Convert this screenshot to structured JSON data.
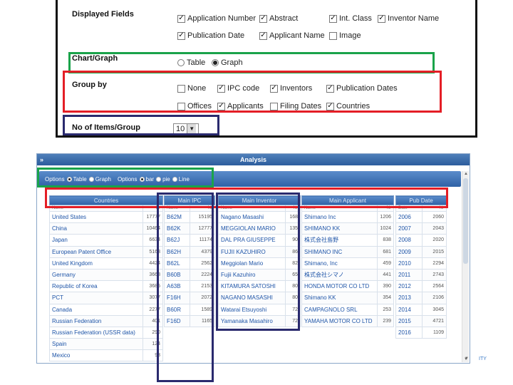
{
  "displayed_fields": {
    "label": "Displayed Fields",
    "options": [
      {
        "label": "Application Number",
        "checked": true
      },
      {
        "label": "Abstract",
        "checked": true
      },
      {
        "label": "Int. Class",
        "checked": true
      },
      {
        "label": "Inventor Name",
        "checked": true
      },
      {
        "label": "Publication Date",
        "checked": true
      },
      {
        "label": "Applicant Name",
        "checked": true
      },
      {
        "label": "Image",
        "checked": false
      }
    ]
  },
  "chart_graph": {
    "label": "Chart/Graph",
    "options": [
      {
        "label": "Table",
        "selected": false
      },
      {
        "label": "Graph",
        "selected": true
      }
    ]
  },
  "group_by": {
    "label": "Group by",
    "options": [
      {
        "label": "None",
        "checked": false
      },
      {
        "label": "IPC code",
        "checked": true
      },
      {
        "label": "Inventors",
        "checked": true
      },
      {
        "label": "Publication Dates",
        "checked": true
      },
      {
        "label": "Offices",
        "checked": false
      },
      {
        "label": "Applicants",
        "checked": true
      },
      {
        "label": "Filing Dates",
        "checked": false
      },
      {
        "label": "Countries",
        "checked": true
      }
    ]
  },
  "items_per_group": {
    "label": "No of Items/Group",
    "value": "10"
  },
  "analysis": {
    "title": "Analysis",
    "collapse": "»",
    "toolbar": {
      "options_label_1": "Options",
      "view_options": [
        {
          "label": "Table",
          "selected": true
        },
        {
          "label": "Graph",
          "selected": false
        }
      ],
      "options_label_2": "Options",
      "chart_options": [
        {
          "label": "bar",
          "selected": true
        },
        {
          "label": "pie",
          "selected": false
        },
        {
          "label": "Line",
          "selected": false
        }
      ]
    },
    "tables": {
      "countries": {
        "header": "Countries",
        "subheaders": [
          "Name",
          "Nr"
        ],
        "rows": [
          [
            "United States",
            "17777"
          ],
          [
            "China",
            "10464"
          ],
          [
            "Japan",
            "6634"
          ],
          [
            "European Patent Office",
            "5163"
          ],
          [
            "United Kingdom",
            "4424"
          ],
          [
            "Germany",
            "3668"
          ],
          [
            "Republic of Korea",
            "3685"
          ],
          [
            "PCT",
            "3077"
          ],
          [
            "Canada",
            "2277"
          ],
          [
            "Russian Federation",
            "401"
          ],
          [
            "Russian Federation (USSR data)",
            "290"
          ],
          [
            "Spain",
            "124"
          ],
          [
            "Mexico",
            "93"
          ]
        ]
      },
      "ipc": {
        "header": "Main IPC",
        "subheaders": [
          "Name",
          "Nr"
        ],
        "rows": [
          [
            "B62M",
            "15195"
          ],
          [
            "B62K",
            "12777"
          ],
          [
            "B62J",
            "11174"
          ],
          [
            "B62H",
            "4379"
          ],
          [
            "B62L",
            "2562"
          ],
          [
            "B60B",
            "2224"
          ],
          [
            "A63B",
            "2153"
          ],
          [
            "F16H",
            "2072"
          ],
          [
            "B60R",
            "1589"
          ],
          [
            "F16D",
            "1165"
          ]
        ]
      },
      "inventor": {
        "header": "Main Inventor",
        "subheaders": [
          "Name",
          "Nr"
        ],
        "rows": [
          [
            "Nagano Masashi",
            "168"
          ],
          [
            "MEGGIOLAN MARIO",
            "135"
          ],
          [
            "DAL PRA GIUSEPPE",
            "90"
          ],
          [
            "FUJII KAZUHIRO",
            "86"
          ],
          [
            "Meggiolan Mario",
            "82"
          ],
          [
            "Fujii Kazuhiro",
            "65"
          ],
          [
            "KITAMURA SATOSHI",
            "80"
          ],
          [
            "NAGANO MASASHI",
            "80"
          ],
          [
            "Watarai Etsuyoshi",
            "72"
          ],
          [
            "Yamanaka Masahiro",
            "72"
          ]
        ]
      },
      "applicant": {
        "header": "Main Applicant",
        "subheaders": [
          "Name",
          "Nr"
        ],
        "rows": [
          [
            "Shimano Inc",
            "1206"
          ],
          [
            "SHIMANO KK",
            "1024"
          ],
          [
            "株式会社島野",
            "838"
          ],
          [
            "SHIMANO INC",
            "681"
          ],
          [
            "Shimano, Inc",
            "459"
          ],
          [
            "株式会社シマノ",
            "441"
          ],
          [
            "HONDA MOTOR CO LTD",
            "390"
          ],
          [
            "Shimano KK",
            "354"
          ],
          [
            "CAMPAGNOLO SRL",
            "253"
          ],
          [
            "YAMAHA MOTOR CO LTD",
            "239"
          ]
        ]
      },
      "pubdate": {
        "header": "Pub Date",
        "subheaders": [
          "Date",
          "Nr"
        ],
        "rows": [
          [
            "2006",
            "2060"
          ],
          [
            "2007",
            "2043"
          ],
          [
            "2008",
            "2020"
          ],
          [
            "2009",
            "2015"
          ],
          [
            "2010",
            "2294"
          ],
          [
            "2011",
            "2743"
          ],
          [
            "2012",
            "2564"
          ],
          [
            "2013",
            "2106"
          ],
          [
            "2014",
            "3045"
          ],
          [
            "2015",
            "4721"
          ],
          [
            "2016",
            "1109"
          ]
        ]
      }
    }
  },
  "footer": {
    "text": "ITY",
    "tick": "▼"
  },
  "colors": {
    "highlight_green": "#1aa34a",
    "highlight_red": "#e41e26",
    "highlight_navy": "#2a2a6e",
    "header_blue": "#2f62a6",
    "link_blue": "#1f55a8"
  }
}
